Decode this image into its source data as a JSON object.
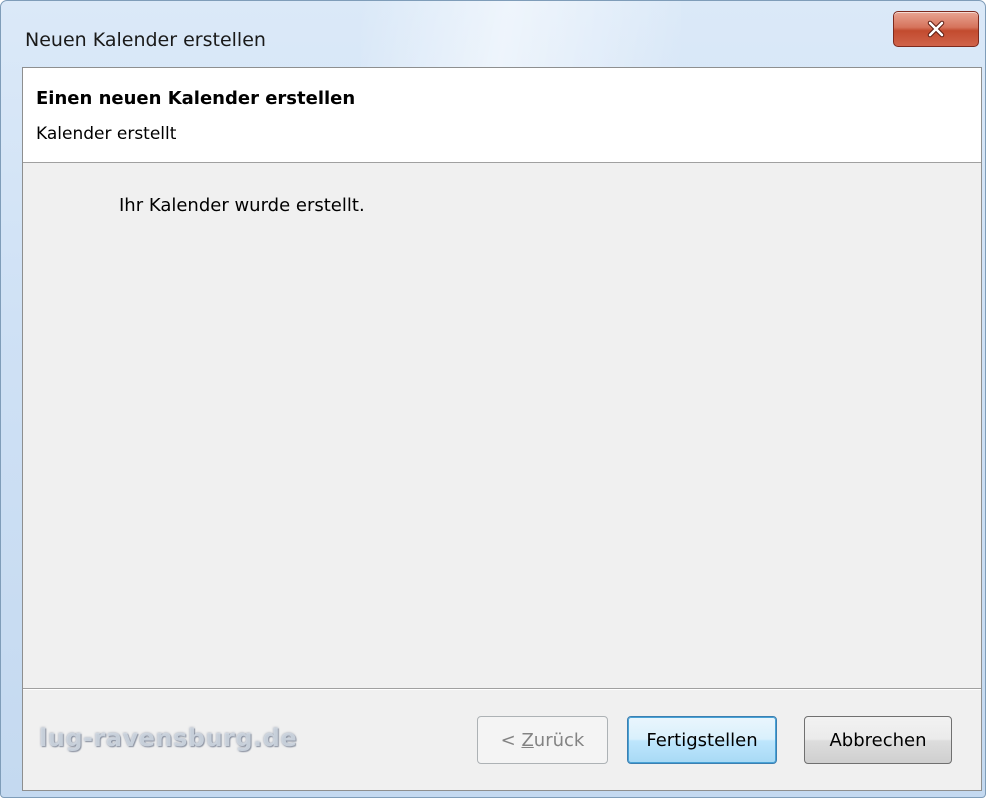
{
  "window": {
    "title": "Neuen Kalender erstellen",
    "close_label": "X"
  },
  "header": {
    "title": "Einen neuen Kalender erstellen",
    "subtitle": "Kalender erstellt"
  },
  "content": {
    "message": "Ihr Kalender wurde erstellt."
  },
  "buttons": {
    "back_prefix": "< ",
    "back_mnemonic": "Z",
    "back_rest": "urück",
    "finish": "Fertigstellen",
    "cancel": "Abbrechen"
  },
  "watermark": {
    "text": "lug-ravensburg.de"
  },
  "colors": {
    "close_button": "#c24b2f",
    "finish_border": "#3c7fb1",
    "dialog_background": "#f0f0f0",
    "header_background": "#ffffff"
  },
  "icons": {
    "close": "close-icon"
  }
}
